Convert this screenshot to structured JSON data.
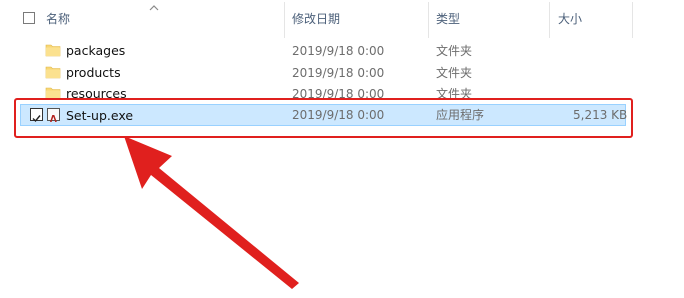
{
  "header": {
    "name_label": "名称",
    "modified_label": "修改日期",
    "type_label": "类型",
    "size_label": "大小"
  },
  "rows": [
    {
      "name": "packages",
      "modified": "2019/9/18 0:00",
      "type": "文件夹",
      "size": ""
    },
    {
      "name": "products",
      "modified": "2019/9/18 0:00",
      "type": "文件夹",
      "size": ""
    },
    {
      "name": "resources",
      "modified": "2019/9/18 0:00",
      "type": "文件夹",
      "size": ""
    },
    {
      "name": "Set-up.exe",
      "modified": "2019/9/18 0:00",
      "type": "应用程序",
      "size": "5,213 KB",
      "selected": true
    }
  ],
  "colors": {
    "selection_fill": "#cce8ff",
    "selection_border": "#99d1ff",
    "annotation_red": "#e0201e",
    "folder_yellow": "#f8d775"
  }
}
